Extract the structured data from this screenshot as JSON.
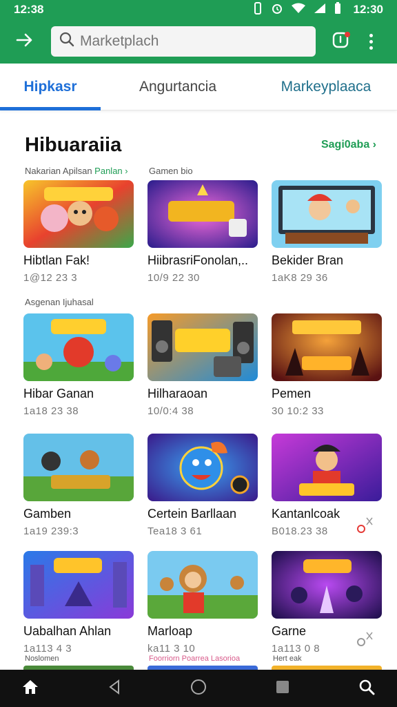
{
  "status": {
    "time_left": "12:38",
    "time_right": "12:30"
  },
  "header": {
    "search_placeholder": "Marketplach",
    "back_icon": "arrow-right-icon",
    "notification_icon": "notification-icon",
    "more_icon": "more-vert-icon"
  },
  "tabs": [
    {
      "label": "Hipkasr",
      "active": true
    },
    {
      "label": "Angurtancia",
      "active": false
    },
    {
      "label": "Markeyplaaca",
      "active": false
    }
  ],
  "section": {
    "title": "Hibuaraiia",
    "see_all": "Sagi0aba ›"
  },
  "rows": [
    {
      "label_main": "Nakarian Apilsan ",
      "label_green": "Panlan ›",
      "label_side": "Gamen bio",
      "cards": [
        {
          "title": "Hibtlan Fak!",
          "meta": "1@12 23 3"
        },
        {
          "title": "HiibrasriFonolan,..",
          "meta": "10/9 22 30"
        },
        {
          "title": "Bekider Bran",
          "meta": "1aK8 29 36"
        }
      ]
    },
    {
      "label_main": "Asgenan Ijuhasal",
      "cards": [
        {
          "title": "Hibar Ganan",
          "meta": "1a18 23 38"
        },
        {
          "title": "Hilharaoan",
          "meta": "10/0:4 38"
        },
        {
          "title": "Pemen",
          "meta": "30 10:2 33"
        }
      ]
    },
    {
      "cards": [
        {
          "title": "Gamben",
          "meta": "1a19 239:3"
        },
        {
          "title": "Certein Barllaan",
          "meta": "Tea18 3 61"
        },
        {
          "title": "Kantanlcoak",
          "meta": "B018.23 38"
        }
      ]
    },
    {
      "cards": [
        {
          "title": "Uabalhan Ahlan",
          "meta": "1a113 4 3"
        },
        {
          "title": "Marloap",
          "meta": "ka11 3 10"
        },
        {
          "title": "Garne",
          "meta": "1a113 0 8"
        }
      ]
    }
  ],
  "bottom_peek": {
    "left": "Noslomen",
    "mid": "Foorriorn Poarrea Lasorioa",
    "right": "Hert eak"
  },
  "nav": [
    "home-icon",
    "back-triangle-icon",
    "home-circle-icon",
    "recents-square-icon",
    "search-icon"
  ],
  "colors": {
    "brand_green": "#1f9d55",
    "tab_active_blue": "#1e6fd8",
    "background": "#ffffff"
  }
}
